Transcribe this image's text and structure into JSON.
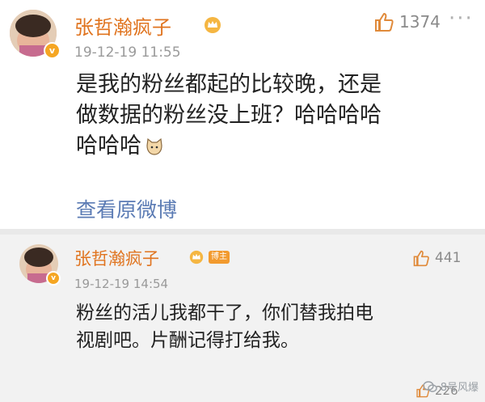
{
  "comments": [
    {
      "username": "张哲瀚疯子",
      "date": "19-12-19 11:55",
      "likes": "1374",
      "text_lines": [
        "是我的粉丝都起的比较晚，还是",
        "做数据的粉丝没上班？哈哈哈哈",
        "哈哈哈"
      ],
      "view_original": "查看原微博"
    },
    {
      "username": "张哲瀚疯子",
      "host_badge": "博主",
      "date": "19-12-19 14:54",
      "likes": "441",
      "text_lines": [
        "粉丝的活儿我都干了，你们替我拍电",
        "视剧吧。片酬记得打给我。"
      ]
    }
  ],
  "partial_like_count": "226",
  "watermark": "8号风爆",
  "colors": {
    "username": "#e0741f",
    "link": "#5b7bb4",
    "badge": "#f5a623"
  }
}
